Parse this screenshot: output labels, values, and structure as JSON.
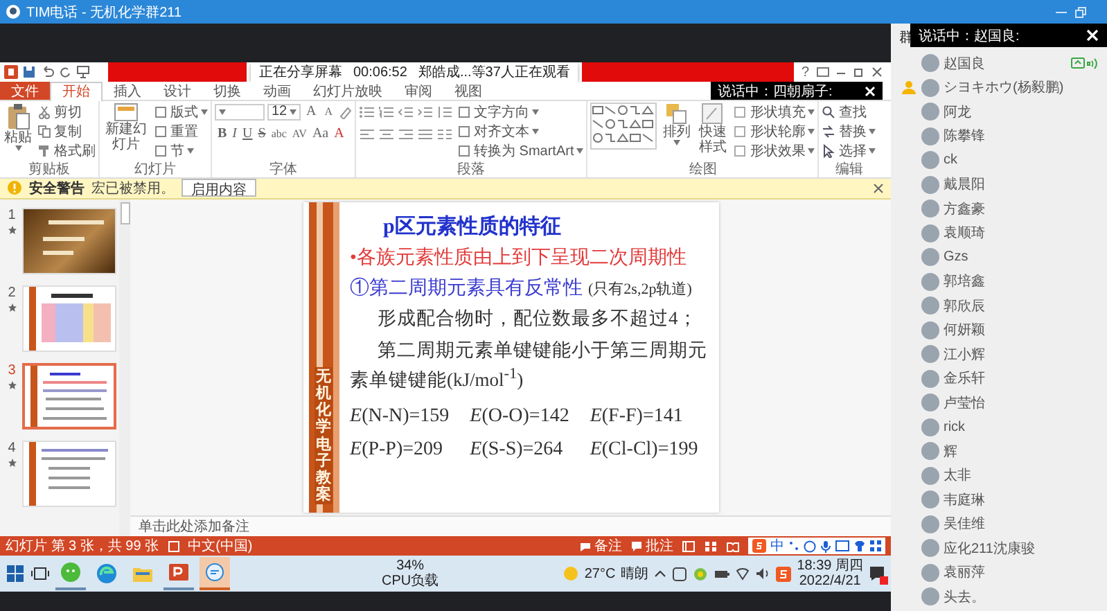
{
  "title_bar": {
    "title": "TIM电话 - 无机化学群211"
  },
  "ppt": {
    "share_bar": {
      "status": "正在分享屏幕",
      "timer": "00:06:52",
      "viewers": "郑皓成...等37人正在观看"
    },
    "speaking_popup": {
      "text": "说话中：四朝扇子:"
    },
    "help": "?",
    "tabs": [
      {
        "label": "文件",
        "kind": "file",
        "selected": false
      },
      {
        "label": "开始",
        "kind": "tab",
        "selected": true
      },
      {
        "label": "插入",
        "kind": "tab",
        "selected": false
      },
      {
        "label": "设计",
        "kind": "tab",
        "selected": false
      },
      {
        "label": "切换",
        "kind": "tab",
        "selected": false
      },
      {
        "label": "动画",
        "kind": "tab",
        "selected": false
      },
      {
        "label": "幻灯片放映",
        "kind": "tab",
        "selected": false
      },
      {
        "label": "审阅",
        "kind": "tab",
        "selected": false
      },
      {
        "label": "视图",
        "kind": "tab",
        "selected": false
      }
    ],
    "ribbon": {
      "clipboard": {
        "label": "剪贴板",
        "large": "粘贴",
        "small": [
          "剪切",
          "复制",
          "格式刷"
        ]
      },
      "slides": {
        "label": "幻灯片",
        "large": "新建幻灯片",
        "small": [
          "版式",
          "重置",
          "节"
        ]
      },
      "font": {
        "label": "字体",
        "size": "12",
        "size_buttons": [
          "A",
          "A"
        ],
        "format_buttons": [
          "B",
          "I",
          "U",
          "S",
          "abc",
          "AV",
          "Aa",
          "A"
        ]
      },
      "paragraph": {
        "label": "段落",
        "small": [
          "文字方向",
          "对齐文本",
          "转换为 SmartArt"
        ]
      },
      "drawing": {
        "label": "绘图",
        "large": [
          "排列",
          "快速样式"
        ],
        "small": [
          "形状填充",
          "形状轮廓",
          "形状效果"
        ]
      },
      "editing": {
        "label": "编辑",
        "small": [
          "查找",
          "替换",
          "选择"
        ]
      }
    },
    "security_bar": {
      "title": "安全警告",
      "message": "宏已被禁用。",
      "button": "启用内容"
    },
    "thumbnails": [
      {
        "number": "1",
        "selected": false
      },
      {
        "number": "2",
        "selected": false
      },
      {
        "number": "3",
        "selected": true
      },
      {
        "number": "4",
        "selected": false
      }
    ],
    "slide": {
      "side_text": "无机化学电子教案",
      "lines": [
        {
          "kind": "title",
          "text": "p区元素性质的特征"
        },
        {
          "kind": "bullet",
          "text": "•各族元素性质由上到下呈现二次周期性"
        },
        {
          "kind": "numbered",
          "text": "①第二周期元素具有反常性",
          "note": "(只有2s,2p轨道)"
        },
        {
          "kind": "body",
          "text": "形成配合物时，配位数最多不超过4；"
        },
        {
          "kind": "body",
          "text": "第二周期元素单键键能小于第三周期元素单键键能(kJ/mol$^{-1}$)"
        }
      ],
      "energies": [
        "*E*(N-N)=159",
        "*E*(O-O)=142",
        "*E*(F-F)=141",
        "*E*(P-P)=209",
        "*E*(S-S)=264",
        "*E*(Cl-Cl)=199"
      ]
    },
    "notes_placeholder": "单击此处添加备注",
    "status_bar": {
      "slide_info": "幻灯片 第 3 张，共 99 张",
      "language": "中文(中国)",
      "notes": "备注",
      "comments": "批注",
      "ime": "中"
    }
  },
  "taskbar": {
    "apps": [
      {
        "running": true,
        "focused": false
      },
      {
        "running": false,
        "focused": false
      },
      {
        "running": false,
        "focused": false
      },
      {
        "running": true,
        "focused": false
      },
      {
        "running": true,
        "focused": true
      }
    ],
    "cpu": {
      "percent": "34%",
      "label": "CPU负载"
    },
    "weather": {
      "temperature": "27°C",
      "condition": "晴朗"
    },
    "clock": {
      "time": "18:39 周四",
      "date": "2022/4/21"
    }
  },
  "members_panel": {
    "header": "群",
    "speaking_popup": "说话中：赵国良:",
    "members": [
      {
        "name": "赵国良",
        "speaking": true,
        "admin": false
      },
      {
        "name": "シヨキホウ(杨毅鹏)",
        "speaking": false,
        "admin": true
      },
      {
        "name": "阿龙",
        "speaking": false,
        "admin": false
      },
      {
        "name": "陈攀锋",
        "speaking": false,
        "admin": false
      },
      {
        "name": "ck",
        "speaking": false,
        "admin": false
      },
      {
        "name": "戴晨阳",
        "speaking": false,
        "admin": false
      },
      {
        "name": "方鑫豪",
        "speaking": false,
        "admin": false
      },
      {
        "name": "袁顺琦",
        "speaking": false,
        "admin": false
      },
      {
        "name": "Gzs",
        "speaking": false,
        "admin": false
      },
      {
        "name": "郭培鑫",
        "speaking": false,
        "admin": false
      },
      {
        "name": "郭欣辰",
        "speaking": false,
        "admin": false
      },
      {
        "name": "何妍颖",
        "speaking": false,
        "admin": false
      },
      {
        "name": "江小辉",
        "speaking": false,
        "admin": false
      },
      {
        "name": "金乐轩",
        "speaking": false,
        "admin": false
      },
      {
        "name": "卢莹怡",
        "speaking": false,
        "admin": false
      },
      {
        "name": "rick",
        "speaking": false,
        "admin": false
      },
      {
        "name": "辉",
        "speaking": false,
        "admin": false
      },
      {
        "name": "太非",
        "speaking": false,
        "admin": false
      },
      {
        "name": "韦庭琳",
        "speaking": false,
        "admin": false
      },
      {
        "name": "吴佳维",
        "speaking": false,
        "admin": false
      },
      {
        "name": "应化211沈康骏",
        "speaking": false,
        "admin": false
      },
      {
        "name": "袁丽萍",
        "speaking": false,
        "admin": false
      },
      {
        "name": "头去。",
        "speaking": false,
        "admin": false
      }
    ]
  }
}
